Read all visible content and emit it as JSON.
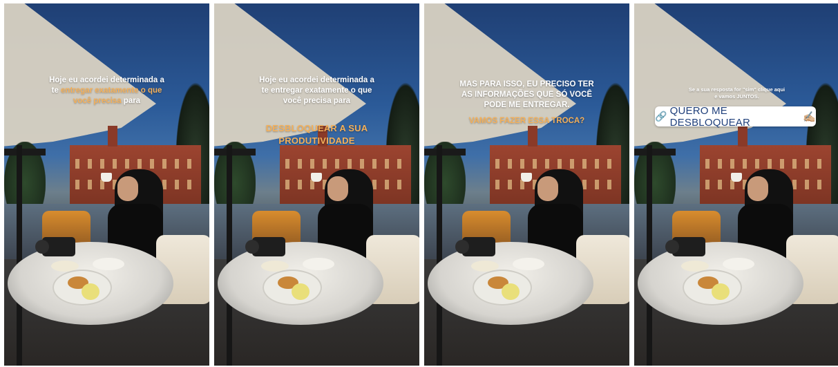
{
  "stories": [
    {
      "lines": [
        {
          "parts": [
            {
              "text": "Hoje eu acordei determinada a",
              "hl": false
            }
          ]
        },
        {
          "parts": [
            {
              "text": "te ",
              "hl": false
            },
            {
              "text": "entregar exatamente o que",
              "hl": true
            }
          ]
        },
        {
          "parts": [
            {
              "text": "você precisa",
              "hl": true
            },
            {
              "text": " para",
              "hl": false
            }
          ]
        }
      ]
    },
    {
      "lines": [
        {
          "parts": [
            {
              "text": "Hoje eu acordei determinada a",
              "hl": false
            }
          ]
        },
        {
          "parts": [
            {
              "text": "te entregar exatamente o que",
              "hl": false
            }
          ]
        },
        {
          "parts": [
            {
              "text": "você precisa para",
              "hl": false
            }
          ]
        }
      ],
      "emphasis": [
        "DESBLOQUEAR A SUA",
        "PRODUTIVIDADE"
      ]
    },
    {
      "lines": [
        {
          "parts": [
            {
              "text": "MAS PARA ISSO, EU PRECISO TER",
              "hl": false
            }
          ]
        },
        {
          "parts": [
            {
              "text": "AS INFORMAÇÕES QUE SÓ VOCÊ",
              "hl": false
            }
          ]
        },
        {
          "parts": [
            {
              "text": "PODE ME ENTREGAR.",
              "hl": false
            }
          ]
        }
      ],
      "emphasis": [
        "VAMOS FAZER ESSA TROCA?"
      ]
    },
    {
      "small_lines": [
        "Se a sua resposta for \"sim\" clique aqui",
        "e vamos JUNTOS."
      ],
      "link_sticker": {
        "icon": "link-icon",
        "label": "QUERO ME DESBLOQUEAR",
        "emoji": "✍🏼"
      }
    }
  ],
  "colors": {
    "highlight": "#f4b05a",
    "sticker_text": "#1f3f7a"
  }
}
